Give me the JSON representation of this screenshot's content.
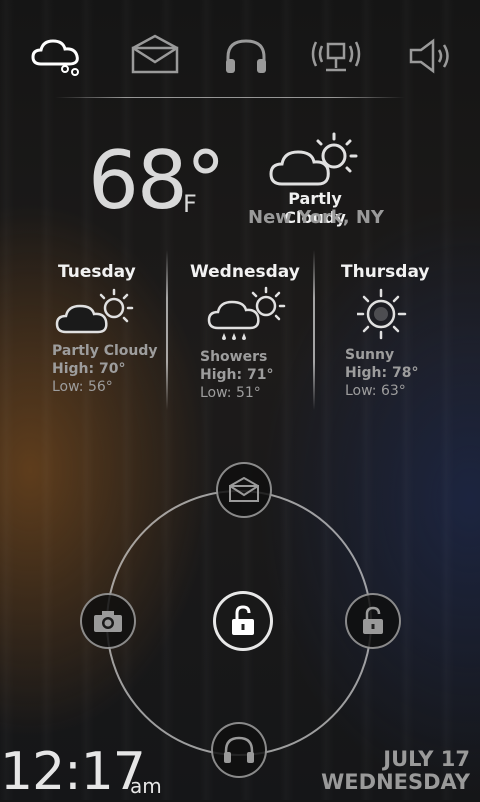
{
  "top_bar": {
    "icons": [
      "cloud-icon",
      "mail-icon",
      "headphones-icon",
      "network-icon",
      "volume-icon"
    ]
  },
  "current": {
    "temp": "68°",
    "unit": "F",
    "condition": "Partly Cloudy",
    "location": "New York, NY",
    "icon": "partly-cloudy-icon"
  },
  "forecast": [
    {
      "day": "Tuesday",
      "icon": "partly-cloudy-icon",
      "condition": "Partly Cloudy",
      "high": "High: 70°",
      "low": "Low: 56°"
    },
    {
      "day": "Wednesday",
      "icon": "showers-icon",
      "condition": "Showers",
      "high": "High: 71°",
      "low": "Low: 51°"
    },
    {
      "day": "Thursday",
      "icon": "sunny-icon",
      "condition": "Sunny",
      "high": "High: 78°",
      "low": "Low: 63°"
    }
  ],
  "lock_ring": {
    "targets": [
      "mail-icon",
      "camera-icon",
      "unlock-icon",
      "unlock-icon",
      "headphones-icon"
    ]
  },
  "clock": {
    "time": "12:17",
    "ampm": "am"
  },
  "date": {
    "line1": "JULY 17",
    "line2": "WEDNESDAY"
  },
  "colors": {
    "accent": "#ffffff",
    "muted_text": "#9a9a9a"
  }
}
